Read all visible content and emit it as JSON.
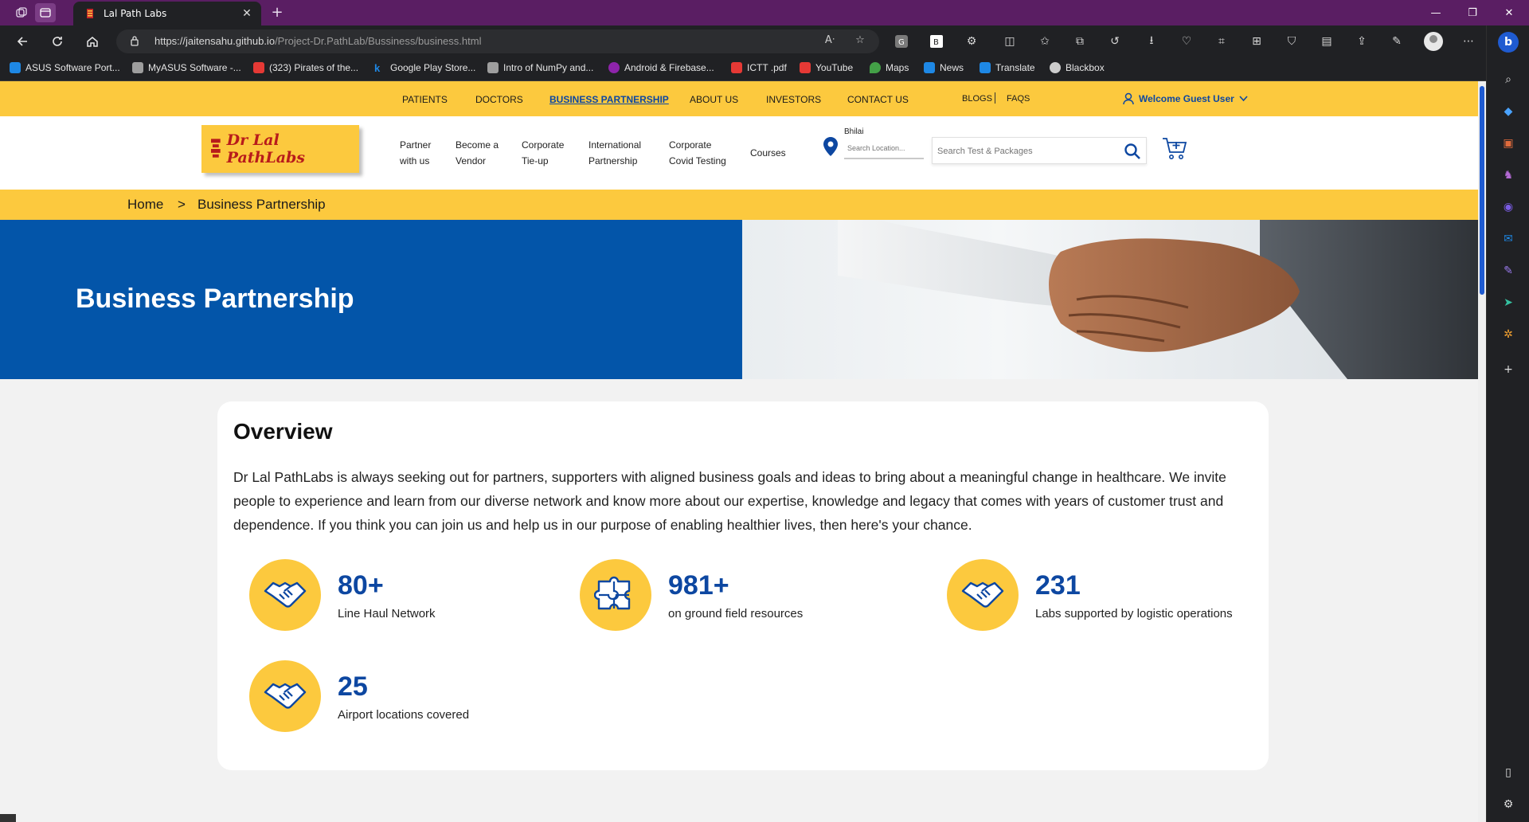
{
  "browser": {
    "tab_title": "Lal Path Labs",
    "url_host": "https://jaitensahu.github.io",
    "url_path": "/Project-Dr.PathLab/Bussiness/business.html",
    "bookmarks": [
      {
        "label": "ASUS Software Port...",
        "color": "#1e88e5"
      },
      {
        "label": "MyASUS Software -...",
        "color": "#9e9e9e"
      },
      {
        "label": "(323) Pirates of the...",
        "color": "#e53935"
      },
      {
        "label": "Google Play Store...",
        "color": "#202124"
      },
      {
        "label": "Intro of NumPy and...",
        "color": "#9e9e9e"
      },
      {
        "label": "Android & Firebase...",
        "color": "#8e24aa"
      },
      {
        "label": "ICTT .pdf",
        "color": "#e53935"
      },
      {
        "label": "YouTube",
        "color": "#e53935"
      },
      {
        "label": "Maps",
        "color": "#43a047"
      },
      {
        "label": "News",
        "color": "#1e88e5"
      },
      {
        "label": "Translate",
        "color": "#1e88e5"
      },
      {
        "label": "Blackbox",
        "color": "#cccccc"
      }
    ]
  },
  "topnav": {
    "patients": "PATIENTS",
    "doctors": "DOCTORS",
    "business": "BUSINESS PARTNERSHIP",
    "about": "ABOUT US",
    "investors": "INVESTORS",
    "contact": "CONTACT US",
    "blogs": "BLOGS",
    "faqs": "FAQS",
    "guest": "Welcome Guest User"
  },
  "header": {
    "logo_text": "Dr Lal PathLabs",
    "links": [
      {
        "line1": "Partner",
        "line2": "with us"
      },
      {
        "line1": "Become a",
        "line2": "Vendor"
      },
      {
        "line1": "Corporate",
        "line2": "Tie-up"
      },
      {
        "line1": "International",
        "line2": "Partnership"
      },
      {
        "line1": "Corporate",
        "line2": "Covid Testing"
      },
      {
        "line1": "Courses",
        "line2": ""
      }
    ],
    "city": "Bhilai",
    "location_placeholder": "Search Location...",
    "search_placeholder": "Search Test & Packages"
  },
  "breadcrumb": {
    "home": "Home",
    "separator": ">",
    "current": "Business Partnership"
  },
  "hero": {
    "title": "Business Partnership"
  },
  "overview": {
    "title": "Overview",
    "text": "Dr Lal PathLabs is always seeking out for partners, supporters with aligned business goals and ideas to bring about a meaningful change in healthcare. We invite people to experience and learn from our diverse network and know more about our expertise, knowledge and legacy that comes with years of customer trust and dependence. If you think you can join us and help us in our purpose of enabling healthier lives, then here's your chance.",
    "stats": [
      {
        "value": "80+",
        "label": "Line Haul Network",
        "icon": "handshake-icon"
      },
      {
        "value": "981+",
        "label": "on ground field resources",
        "icon": "puzzle-icon"
      },
      {
        "value": "231",
        "label": "Labs supported by logistic operations",
        "icon": "handshake-icon"
      },
      {
        "value": "25",
        "label": "Airport locations covered",
        "icon": "handshake-icon"
      }
    ]
  },
  "colors": {
    "brand_yellow": "#fcc93e",
    "brand_blue": "#0355a9",
    "stat_blue": "#0d47a1"
  }
}
